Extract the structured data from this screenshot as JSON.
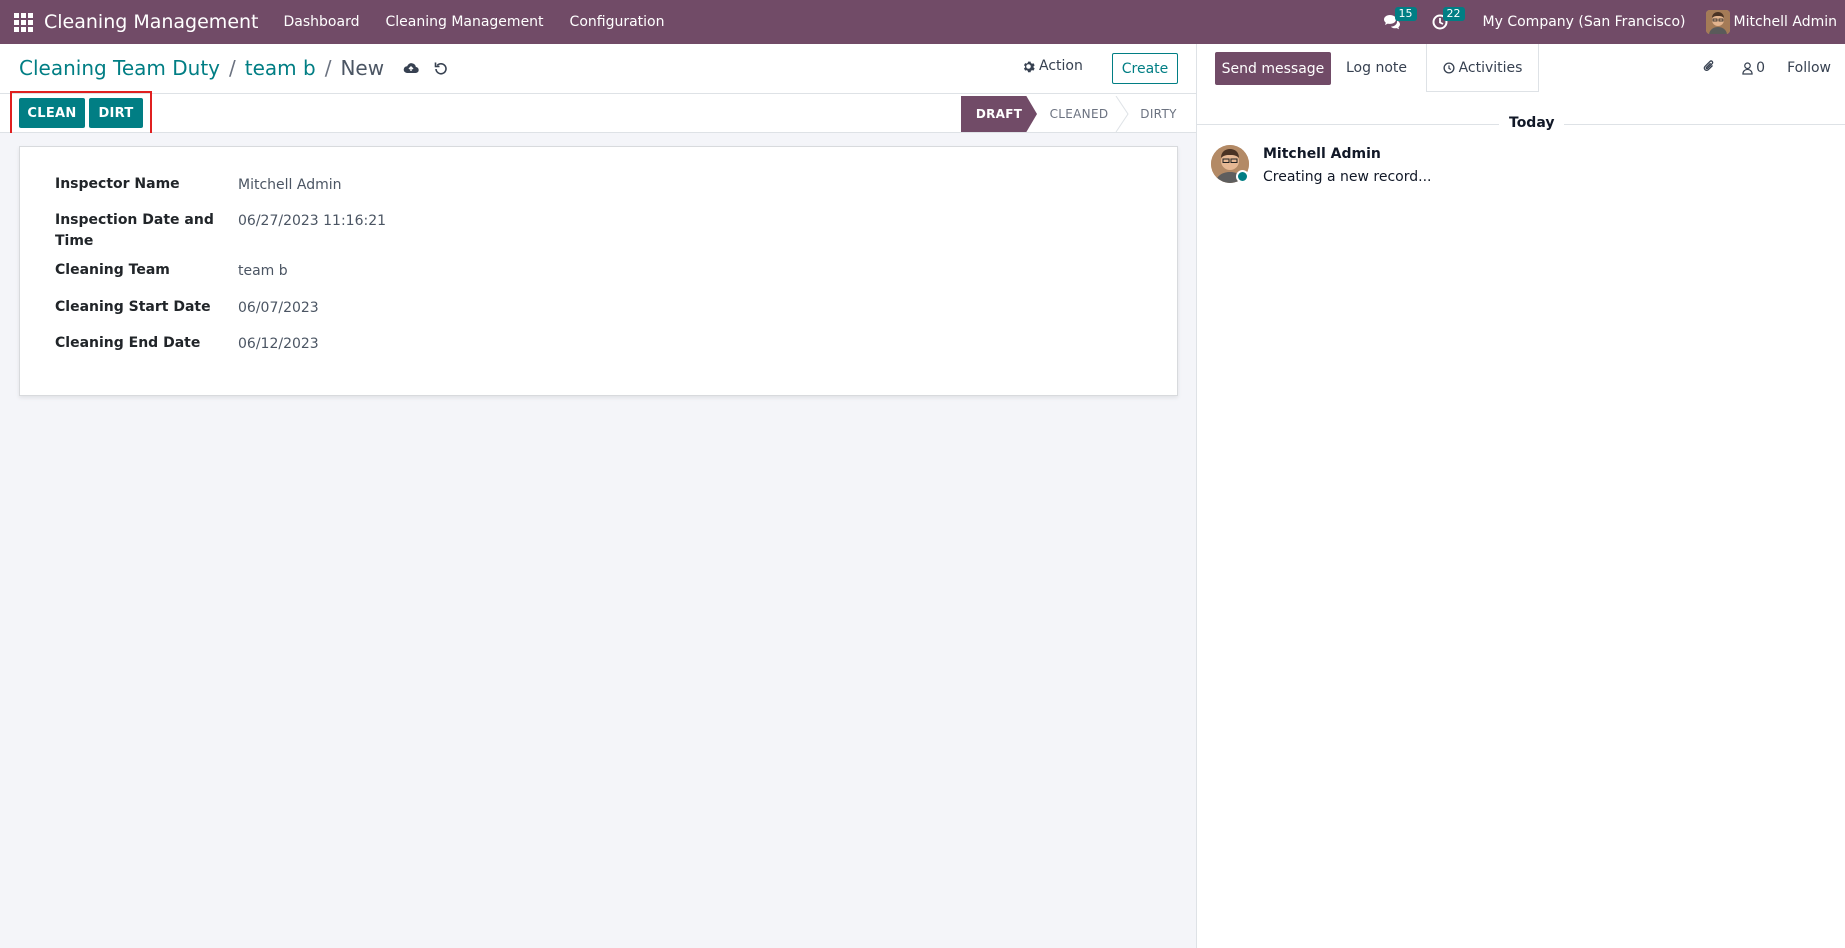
{
  "navbar": {
    "app_name": "Cleaning Management",
    "menu": [
      "Dashboard",
      "Cleaning Management",
      "Configuration"
    ],
    "messages_count": "15",
    "activities_count": "22",
    "company": "My Company (San Francisco)",
    "user": "Mitchell Admin"
  },
  "breadcrumb": {
    "root": "Cleaning Team Duty",
    "parent": "team b",
    "current": "New",
    "separator": "/"
  },
  "control": {
    "action_label": "Action",
    "create_label": "Create"
  },
  "header_buttons": {
    "clean": "CLEAN",
    "dirt": "DIRT"
  },
  "stages": {
    "draft": "DRAFT",
    "cleaned": "CLEANED",
    "dirty": "DIRTY",
    "active": "DRAFT"
  },
  "form": {
    "fields": [
      {
        "label": "Inspector Name",
        "value": "Mitchell Admin"
      },
      {
        "label_line1": "Inspection Date and",
        "label_line2": "Time",
        "value": "06/27/2023 11:16:21"
      },
      {
        "label": "Cleaning Team",
        "value": "team b"
      },
      {
        "label": "Cleaning Start Date",
        "value": "06/07/2023"
      },
      {
        "label": "Cleaning End Date",
        "value": "06/12/2023"
      }
    ]
  },
  "chatter": {
    "send_message": "Send message",
    "log_note": "Log note",
    "activities": "Activities",
    "followers_count": "0",
    "follow": "Follow",
    "date_separator": "Today",
    "message": {
      "author": "Mitchell Admin",
      "body": "Creating a new record..."
    }
  },
  "colors": {
    "brand": "#714B67",
    "accent": "#017E84",
    "highlight": "#e02020"
  }
}
